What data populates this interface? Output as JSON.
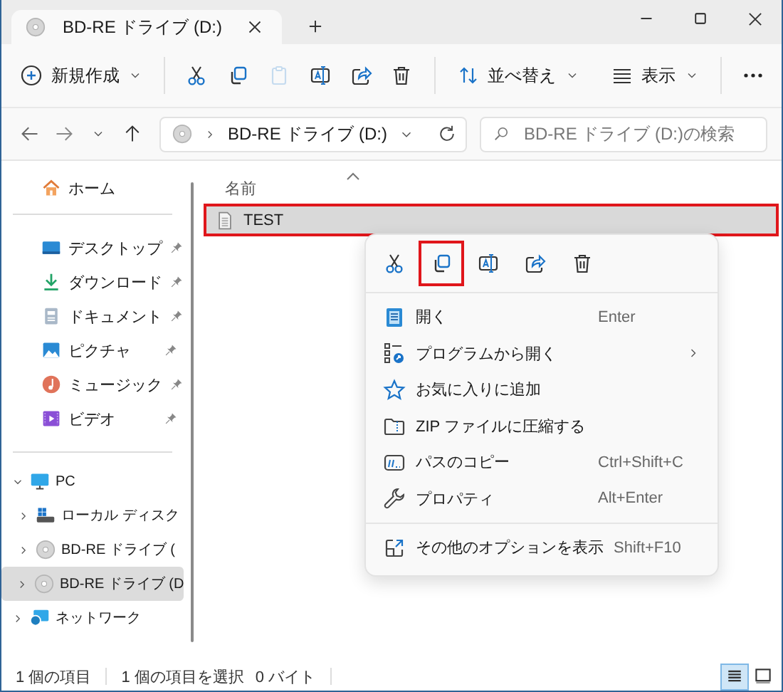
{
  "window": {
    "tab": {
      "title": "BD-RE ドライブ (D:)",
      "selected": true
    }
  },
  "toolbar": {
    "new_button": {
      "label": "新規作成"
    },
    "actions": [
      {
        "kind": "cut",
        "disabled": false
      },
      {
        "kind": "copy",
        "disabled": false
      },
      {
        "kind": "paste",
        "disabled": true
      },
      {
        "kind": "rename",
        "disabled": false
      },
      {
        "kind": "share",
        "disabled": false
      },
      {
        "kind": "delete",
        "disabled": false
      }
    ],
    "sort_button": {
      "label": "並べ替え"
    },
    "view_button": {
      "label": "表示"
    }
  },
  "address_bar": {
    "path": "BD-RE ドライブ (D:)"
  },
  "search": {
    "placeholder": "BD-RE ドライブ (D:)の検索"
  },
  "sidebar": {
    "home": {
      "label": "ホーム"
    },
    "quick_access": [
      {
        "label": "デスクトップ",
        "kind": "desktop",
        "pinned": true
      },
      {
        "label": "ダウンロード",
        "kind": "download",
        "pinned": true
      },
      {
        "label": "ドキュメント",
        "kind": "documents",
        "pinned": true
      },
      {
        "label": "ピクチャ",
        "kind": "pictures",
        "pinned": true
      },
      {
        "label": "ミュージック",
        "kind": "music",
        "pinned": true
      },
      {
        "label": "ビデオ",
        "kind": "video",
        "pinned": true
      }
    ],
    "tree": [
      {
        "label": "PC",
        "kind": "pc",
        "expanded": true,
        "selected": false,
        "children": [
          {
            "label": "ローカル ディスク",
            "kind": "drive",
            "expanded": false,
            "selected": false
          },
          {
            "label": "BD-RE ドライブ (",
            "kind": "disc",
            "expanded": false,
            "selected": false
          },
          {
            "label": "BD-RE ドライブ (D",
            "kind": "disc",
            "expanded": false,
            "selected": true
          }
        ]
      },
      {
        "label": "ネットワーク",
        "kind": "network",
        "expanded": false,
        "selected": false
      }
    ]
  },
  "file_list": {
    "columns": [
      {
        "label": "名前",
        "sorted": true
      }
    ],
    "rows": [
      {
        "name": "TEST",
        "kind": "text-file",
        "selected": true,
        "highlighted": true
      }
    ]
  },
  "context_menu": {
    "actions": [
      {
        "kind": "cut",
        "highlighted": false
      },
      {
        "kind": "copy",
        "highlighted": true
      },
      {
        "kind": "rename",
        "highlighted": false
      },
      {
        "kind": "share",
        "highlighted": false
      },
      {
        "kind": "delete",
        "highlighted": false
      }
    ],
    "sections": [
      {
        "items": [
          {
            "label": "開く",
            "shortcut": "Enter",
            "kind": "open",
            "submenu": false
          },
          {
            "label": "プログラムから開く",
            "kind": "open-with",
            "submenu": true
          },
          {
            "label": "お気に入りに追加",
            "kind": "star",
            "submenu": false
          },
          {
            "label": "ZIP ファイルに圧縮する",
            "kind": "zip",
            "submenu": false
          },
          {
            "label": "パスのコピー",
            "shortcut": "Ctrl+Shift+C",
            "kind": "copy-path",
            "submenu": false
          },
          {
            "label": "プロパティ",
            "shortcut": "Alt+Enter",
            "kind": "properties",
            "submenu": false
          }
        ]
      },
      {
        "items": [
          {
            "label": "その他のオプションを表示",
            "shortcut": "Shift+F10",
            "kind": "more-options",
            "submenu": false
          }
        ]
      }
    ]
  },
  "status_bar": {
    "item_count": "1 個の項目",
    "selection": "1 個の項目を選択",
    "size": "0 バイト",
    "views": [
      {
        "kind": "details",
        "selected": true
      },
      {
        "kind": "tiles",
        "selected": false
      }
    ]
  }
}
